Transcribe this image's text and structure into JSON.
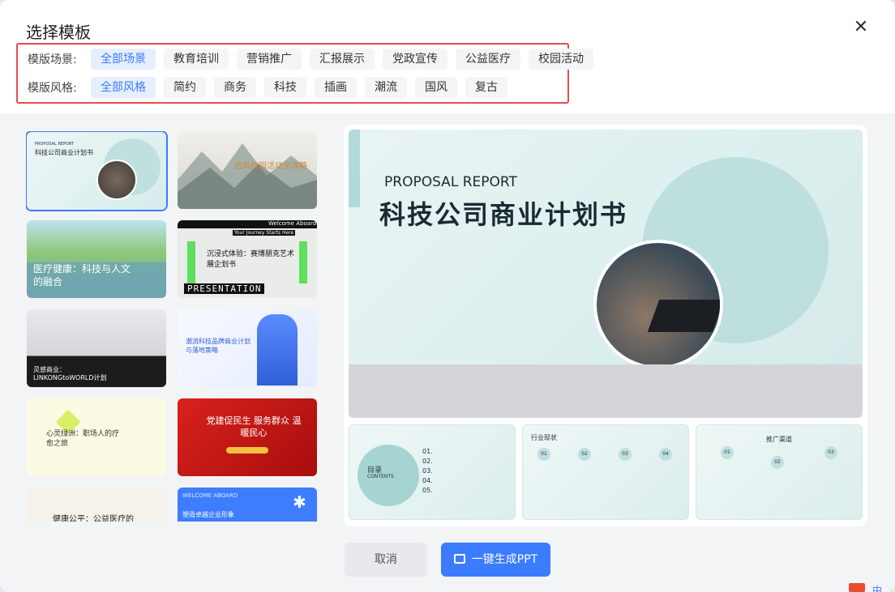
{
  "dialog": {
    "title": "选择模板",
    "close_icon": "close-icon"
  },
  "filters": {
    "scene": {
      "label": "模版场景:",
      "options": [
        "全部场景",
        "教育培训",
        "营销推广",
        "汇报展示",
        "党政宣传",
        "公益医疗",
        "校园活动"
      ],
      "selected": "全部场景"
    },
    "style": {
      "label": "模版风格:",
      "options": [
        "全部风格",
        "简约",
        "商务",
        "科技",
        "插画",
        "潮流",
        "国风",
        "复古"
      ],
      "selected": "全部风格"
    }
  },
  "templates": [
    {
      "title": "科技公司商业计划书",
      "kicker": "PROPOSAL REPORT"
    },
    {
      "title": "古风校园活动全攻略"
    },
    {
      "title": "医疗健康：科技与人文的融合"
    },
    {
      "title": "沉浸式体验：赛博朋克艺术展企划书",
      "kicker": "Welcome Aboard",
      "sub": "Your Journey Starts Here",
      "banner": "PRESENTATION"
    },
    {
      "title": "灵感商业：LINKONGtoWORLD计划"
    },
    {
      "title": "潮流科技品牌商业计划与落地策略"
    },
    {
      "title": "心灵绿洲：职场人的疗愈之旅"
    },
    {
      "title": "党建促民生 服务群众 温暖民心"
    },
    {
      "title": "健康公平：公益医疗的"
    },
    {
      "title": "塑造卓越企业形象",
      "kicker": "WELCOME ABOARD"
    }
  ],
  "preview": {
    "kicker": "PROPOSAL REPORT",
    "title": "科技公司商业计划书",
    "pages": [
      {
        "heading": "目录",
        "sub": "CONTENTS",
        "items": [
          "01.",
          "02.",
          "03.",
          "04.",
          "05."
        ]
      },
      {
        "heading": "行业现状",
        "items": [
          "01",
          "02",
          "03",
          "04"
        ]
      },
      {
        "heading": "推广渠道",
        "items": [
          "01",
          "02",
          "03"
        ]
      }
    ]
  },
  "buttons": {
    "cancel": "取消",
    "generate": "一键生成PPT",
    "generate_icon": "presentation-icon"
  },
  "colors": {
    "accent": "#3b7bff",
    "highlight_border": "#e84c4c",
    "teal": "#8cc9c8"
  }
}
